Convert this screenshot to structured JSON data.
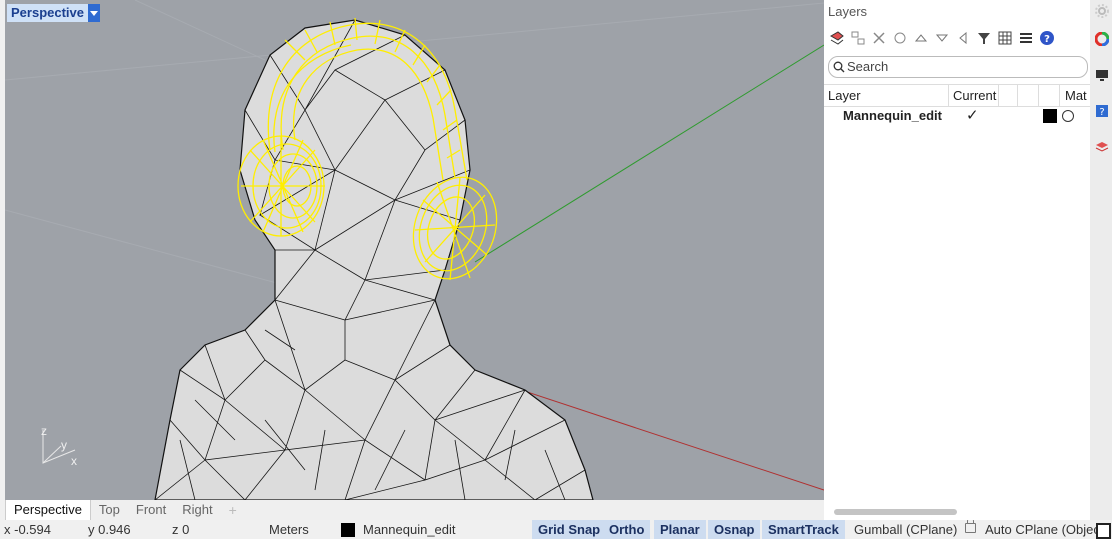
{
  "viewport": {
    "title": "Perspective",
    "axes": {
      "z": "z",
      "y": "y",
      "x": "x"
    }
  },
  "viewport_tabs": [
    "Perspective",
    "Top",
    "Front",
    "Right",
    "+"
  ],
  "status": {
    "x": "x -0.594",
    "y": "y 0.946",
    "z": "z 0",
    "units": "Meters",
    "layer": "Mannequin_edit",
    "layer_color": "#000000",
    "panes": [
      "Grid Snap",
      "Ortho",
      "Planar",
      "Osnap",
      "SmartTrack"
    ],
    "gumball": "Gumball (CPlane)",
    "autocplane": "Auto CPlane (Object"
  },
  "layers_panel": {
    "title": "Layers",
    "search_placeholder": "Search",
    "columns": [
      "Layer",
      "Current",
      "",
      "",
      "Mat"
    ],
    "rows": [
      {
        "name": "Mannequin_edit",
        "current": "✓",
        "color": "#000000"
      }
    ]
  },
  "colors": {
    "selection": "#ffee00",
    "viewport_bg": "#9ea2a8",
    "x_axis": "#b03030",
    "y_axis": "#2f9b2f",
    "active_pane": "#cddcf0"
  }
}
